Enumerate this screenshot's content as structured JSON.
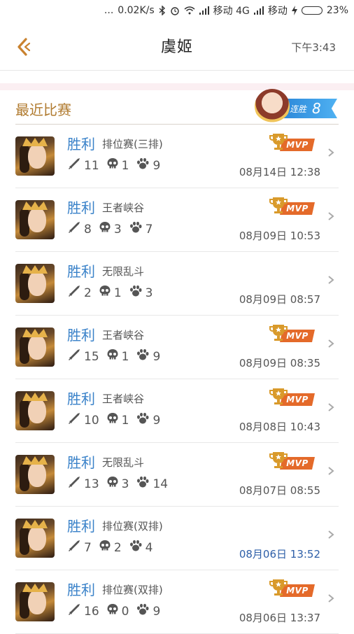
{
  "status_bar": {
    "time": "下午3:43",
    "dots": "...",
    "speed": "0.02K/s",
    "carrier1": "移动 4G",
    "carrier2": "移动",
    "battery": "23%",
    "battery_level": 0.23
  },
  "header": {
    "title": "虞姬"
  },
  "section": {
    "title": "最近比赛",
    "streak_label": "连胜",
    "streak_count": "8"
  },
  "colors": {
    "win": "#3a82c9",
    "section_title": "#b07a2e",
    "mvp": "#e46a2a",
    "highlight_time": "#2e5fa8"
  },
  "mvp_label": "MVP",
  "matches": [
    {
      "result": "胜利",
      "mode": "排位赛(三排)",
      "kills": "11",
      "deaths": "1",
      "assists": "9",
      "time": "08月14日 12:38",
      "mvp": true
    },
    {
      "result": "胜利",
      "mode": "王者峡谷",
      "kills": "8",
      "deaths": "3",
      "assists": "7",
      "time": "08月09日 10:53",
      "mvp": true
    },
    {
      "result": "胜利",
      "mode": "无限乱斗",
      "kills": "2",
      "deaths": "1",
      "assists": "3",
      "time": "08月09日 08:57",
      "mvp": false
    },
    {
      "result": "胜利",
      "mode": "王者峡谷",
      "kills": "15",
      "deaths": "1",
      "assists": "9",
      "time": "08月09日 08:35",
      "mvp": true
    },
    {
      "result": "胜利",
      "mode": "王者峡谷",
      "kills": "10",
      "deaths": "1",
      "assists": "9",
      "time": "08月08日 10:43",
      "mvp": true
    },
    {
      "result": "胜利",
      "mode": "无限乱斗",
      "kills": "13",
      "deaths": "3",
      "assists": "14",
      "time": "08月07日 08:55",
      "mvp": true
    },
    {
      "result": "胜利",
      "mode": "排位赛(双排)",
      "kills": "7",
      "deaths": "2",
      "assists": "4",
      "time": "08月06日 13:52",
      "mvp": false,
      "highlight": true
    },
    {
      "result": "胜利",
      "mode": "排位赛(双排)",
      "kills": "16",
      "deaths": "0",
      "assists": "9",
      "time": "08月06日 13:37",
      "mvp": true
    }
  ]
}
